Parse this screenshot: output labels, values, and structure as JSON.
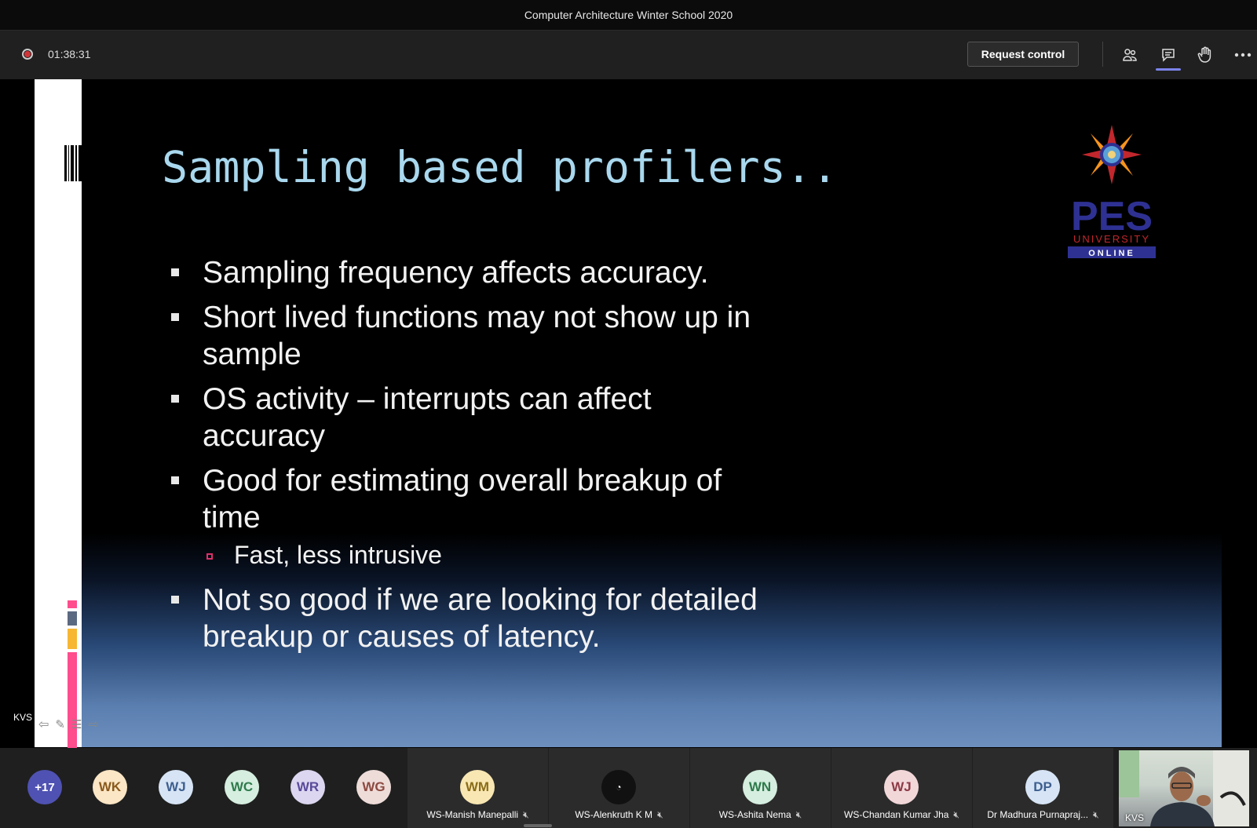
{
  "window": {
    "title": "Computer Architecture Winter School 2020"
  },
  "toolbar": {
    "timer": "01:38:31",
    "request_control": "Request control",
    "icons": [
      "participants-icon",
      "chat-icon",
      "raise-hand-icon",
      "more-options-icon"
    ]
  },
  "slide": {
    "title": "Sampling based profilers..",
    "bullets": [
      "Sampling frequency affects accuracy.",
      "Short lived functions may not show up in sample",
      "OS activity – interrupts can affect accuracy",
      "Good for estimating overall breakup of time",
      "Not so good if we are looking for detailed breakup or causes of latency."
    ],
    "sub_bullet": "Fast, less intrusive",
    "logo": {
      "name": "PES",
      "line2": "UNIVERSITY",
      "line3": "ONLINE"
    },
    "colors": {
      "title": "#a9d8ee",
      "sub_bullet_marker": "#e0306a",
      "logo": "#2e3192",
      "logo_accent": "#c1272d"
    }
  },
  "presenter": {
    "label": "KVS"
  },
  "roster": {
    "overflow": "+17",
    "initials": [
      {
        "initials": "WK",
        "bg": "#fbe6c5",
        "fg": "#8a5a1d"
      },
      {
        "initials": "WJ",
        "bg": "#d6e4f5",
        "fg": "#3d5f8e"
      },
      {
        "initials": "WC",
        "bg": "#d5eedf",
        "fg": "#2f7a4c"
      },
      {
        "initials": "WR",
        "bg": "#dcd6f0",
        "fg": "#5a4a9a"
      },
      {
        "initials": "WG",
        "bg": "#eedcd9",
        "fg": "#8c4a40"
      }
    ],
    "tiles": [
      {
        "initials": "WM",
        "name": "WS-Manish Manepalli",
        "bg": "#f9e7b3",
        "fg": "#8a6d1a"
      },
      {
        "initials": "",
        "name": "WS-Alenkruth K M",
        "bg": "#111",
        "fg": "#fff"
      },
      {
        "initials": "WN",
        "name": "WS-Ashita Nema",
        "bg": "#d5eedf",
        "fg": "#2f7a4c"
      },
      {
        "initials": "WJ",
        "name": "WS-Chandan Kumar Jha",
        "bg": "#f2d7d9",
        "fg": "#8c3a46"
      },
      {
        "initials": "DP",
        "name": "Dr Madhura Purnapraj...",
        "bg": "#d6e4f5",
        "fg": "#3d5f8e"
      }
    ],
    "video": {
      "name": "KVS"
    }
  }
}
